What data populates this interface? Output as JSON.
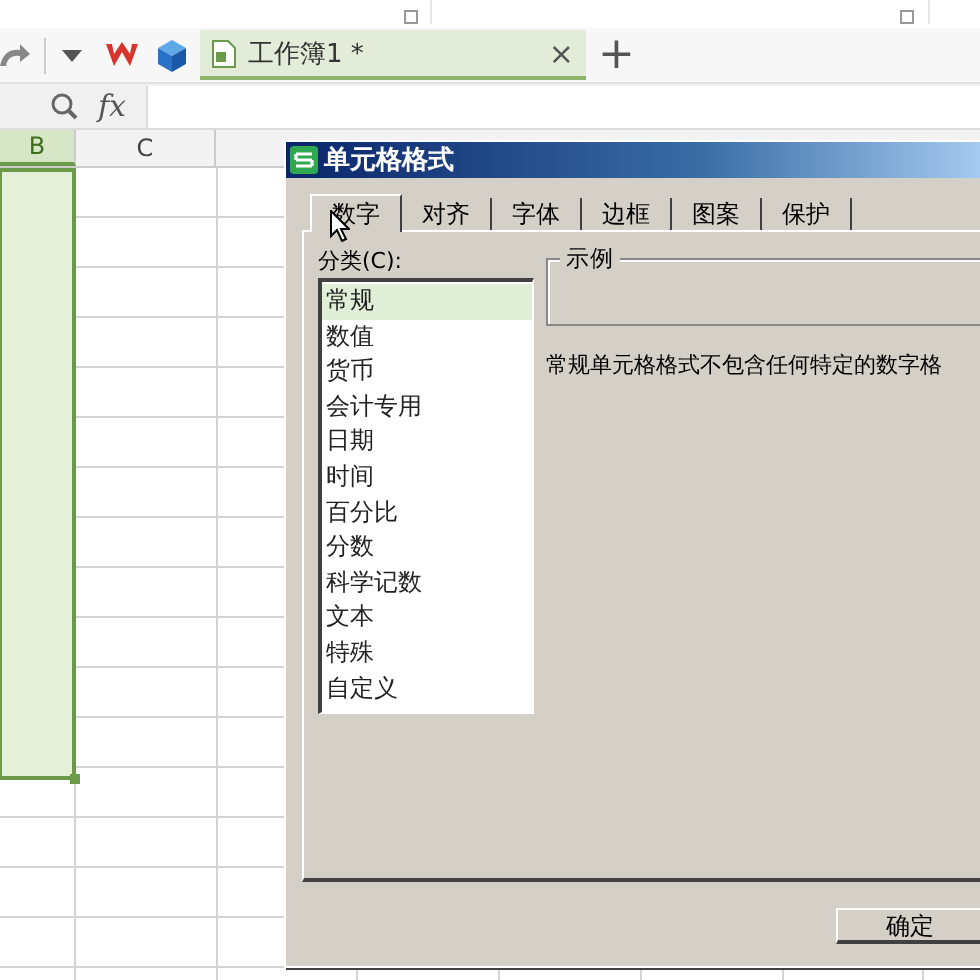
{
  "tab_bar": {
    "document_tab": {
      "title": "工作簿1 *",
      "close": "×",
      "selected": true
    },
    "new_tab": "+"
  },
  "formula_bar": {
    "function_label": "fx"
  },
  "sheet": {
    "columns": [
      {
        "label": "B",
        "selected": true
      },
      {
        "label": "C",
        "selected": false
      }
    ]
  },
  "dialog": {
    "title": "单元格格式",
    "tabs": [
      {
        "label": "数字",
        "selected": true
      },
      {
        "label": "对齐",
        "selected": false
      },
      {
        "label": "字体",
        "selected": false
      },
      {
        "label": "边框",
        "selected": false
      },
      {
        "label": "图案",
        "selected": false
      },
      {
        "label": "保护",
        "selected": false
      }
    ],
    "category_label": "分类(C):",
    "categories": [
      {
        "label": "常规",
        "selected": true
      },
      {
        "label": "数值",
        "selected": false
      },
      {
        "label": "货币",
        "selected": false
      },
      {
        "label": "会计专用",
        "selected": false
      },
      {
        "label": "日期",
        "selected": false
      },
      {
        "label": "时间",
        "selected": false
      },
      {
        "label": "百分比",
        "selected": false
      },
      {
        "label": "分数",
        "selected": false
      },
      {
        "label": "科学记数",
        "selected": false
      },
      {
        "label": "文本",
        "selected": false
      },
      {
        "label": "特殊",
        "selected": false
      },
      {
        "label": "自定义",
        "selected": false
      }
    ],
    "sample_label": "示例",
    "description": "常规单元格格式不包含任何特定的数字格",
    "buttons": [
      "确定"
    ]
  }
}
